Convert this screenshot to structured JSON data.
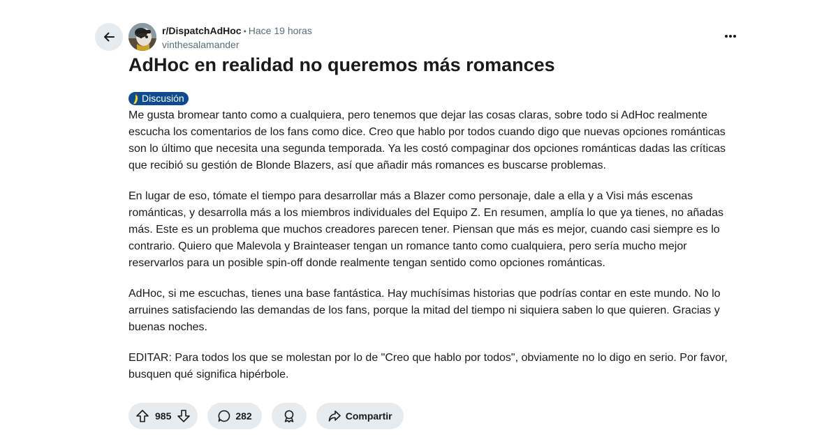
{
  "header": {
    "subreddit": "r/DispatchAdHoc",
    "separator": "•",
    "time": "Hace 19 horas",
    "author": "vinthesalamander",
    "icons": {
      "back": "arrow-left-icon",
      "more": "more-horizontal-icon",
      "avatar": "subreddit-avatar"
    }
  },
  "post": {
    "title": "AdHoc en realidad no queremos más romances",
    "flair": {
      "emoji": "banana-icon",
      "label": "Discusión",
      "color": "#0d4b8e"
    },
    "paragraphs": [
      "Me gusta bromear tanto como a cualquiera, pero tenemos que dejar las cosas claras, sobre todo si AdHoc realmente escucha los comentarios de los fans como dice. Creo que hablo por todos cuando digo que nuevas opciones románticas son lo último que necesita una segunda temporada. Ya les costó compaginar dos opciones románticas dadas las críticas que recibió su gestión de Blonde Blazers, así que añadir más romances es buscarse problemas.",
      "En lugar de eso, tómate el tiempo para desarrollar más a Blazer como personaje, dale a ella y a Visi más escenas románticas, y desarrolla más a los miembros individuales del Equipo Z. En resumen, amplía lo que ya tienes, no añadas más. Este es un problema que muchos creadores parecen tener. Piensan que más es mejor, cuando casi siempre es lo contrario. Quiero que Malevola y Brainteaser tengan un romance tanto como cualquiera, pero sería mucho mejor reservarlos para un posible spin-off donde realmente tengan sentido como opciones románticas.",
      "AdHoc, si me escuchas, tienes una base fantástica. Hay muchísimas historias que podrías contar en este mundo. No lo arruines satisfaciendo las demandas de los fans, porque la mitad del tiempo ni siquiera saben lo que quieren. Gracias y buenas noches.",
      "EDITAR: Para todos los que se molestan por lo de \"Creo que hablo por todos\", obviamente no lo digo en serio. Por favor, busquen qué significa hipérbole."
    ]
  },
  "actions": {
    "votes": "985",
    "comments": "282",
    "share": "Compartir",
    "icons": {
      "upvote": "upvote-arrow-icon",
      "downvote": "downvote-arrow-icon",
      "comment": "comment-bubble-icon",
      "award": "award-icon",
      "share": "share-arrow-icon"
    }
  },
  "colors": {
    "pill_background": "#e5ebee",
    "meta_text": "#576f76",
    "flair_background": "#0d4b8e"
  }
}
